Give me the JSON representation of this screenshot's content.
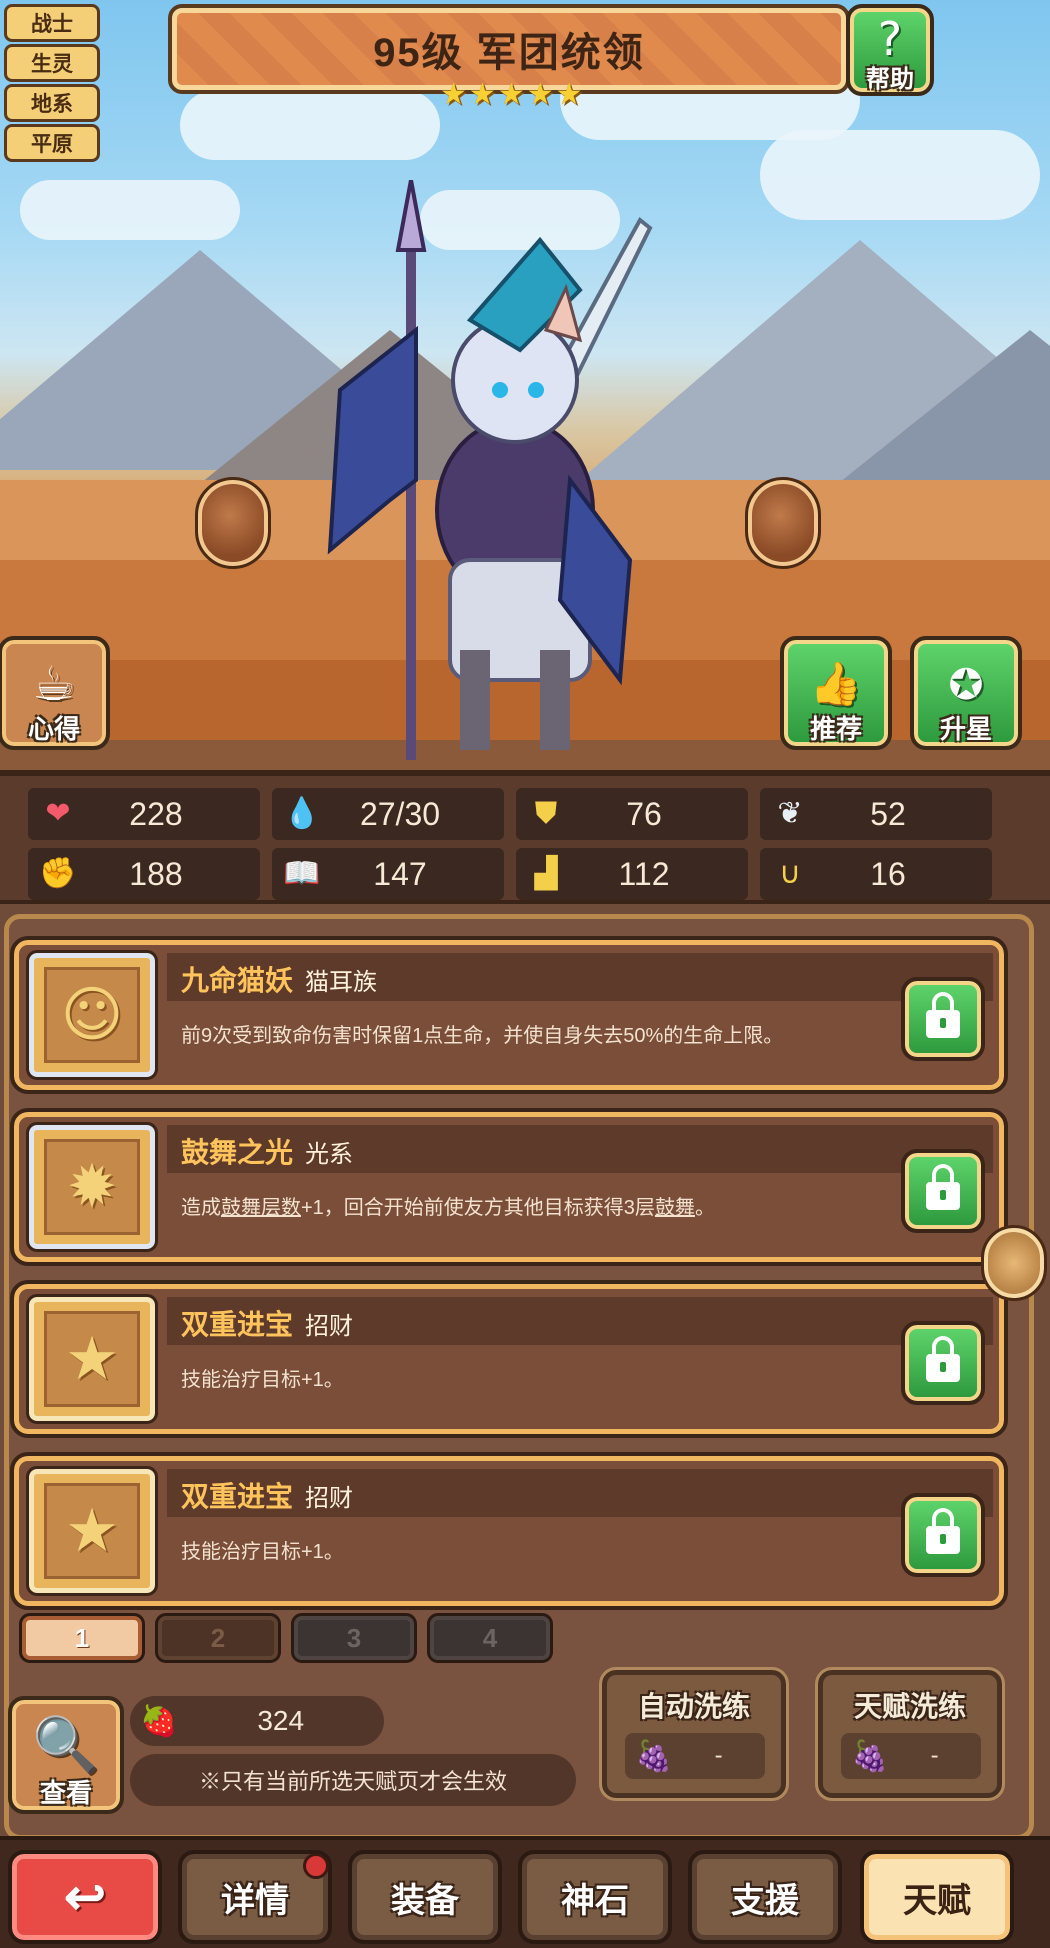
{
  "hero": {
    "tags": [
      "战士",
      "生灵",
      "地系",
      "平原"
    ],
    "title": "95级  军团统领",
    "stars": 5
  },
  "scene_buttons": {
    "help": "帮助",
    "notes": "心得",
    "recommend": "推荐",
    "upstar": "升星"
  },
  "icons": {
    "help": "question-mark-icon",
    "notes": "notes-icon",
    "recommend": "thumbs-up-icon",
    "upstar": "star-up-icon",
    "view": "magnifier-icon",
    "back": "back-arrow-icon",
    "lock": "lock-icon",
    "currency": "fruit-icon"
  },
  "stats": [
    {
      "icon": "heart-icon",
      "value": "228",
      "color": "#f45a6a"
    },
    {
      "icon": "water-drop-icon",
      "value": "27/30",
      "color": "#7fd0f4"
    },
    {
      "icon": "shield-icon",
      "value": "76",
      "color": "#f4d04a"
    },
    {
      "icon": "wing-icon",
      "value": "52",
      "color": "#e8eef6"
    },
    {
      "icon": "fist-icon",
      "value": "188",
      "color": "#f47a6a"
    },
    {
      "icon": "book-icon",
      "value": "147",
      "color": "#7fd0f4"
    },
    {
      "icon": "boot-icon",
      "value": "112",
      "color": "#f4d04a"
    },
    {
      "icon": "horseshoe-icon",
      "value": "16",
      "color": "#f4d04a"
    }
  ],
  "talents": [
    {
      "name": "九命猫妖",
      "type": "猫耳族",
      "desc_parts": [
        "前9次受到致命伤害时保留1点生命，并使自身失去50%的生命上限。"
      ],
      "icon": "cat-head-icon",
      "icon_glyph": "☺"
    },
    {
      "name": "鼓舞之光",
      "type": "光系",
      "desc_parts": [
        "造成",
        "鼓舞层数",
        "+1，回合开始前使友方其他目标获得3层",
        "鼓舞",
        "。"
      ],
      "icon": "sun-icon",
      "icon_glyph": "✹"
    },
    {
      "name": "双重进宝",
      "type": "招财",
      "desc_parts": [
        "技能治疗目标+1。"
      ],
      "icon": "star-exclaim-icon",
      "icon_glyph": "★"
    },
    {
      "name": "双重进宝",
      "type": "招财",
      "desc_parts": [
        "技能治疗目标+1。"
      ],
      "icon": "star-exclaim-icon",
      "icon_glyph": "★"
    }
  ],
  "pages": [
    "1",
    "2",
    "3",
    "4"
  ],
  "currency": {
    "value": "324"
  },
  "hint": "※只有当前所选天赋页才会生效",
  "view_label": "查看",
  "wash": {
    "auto": {
      "title": "自动洗练",
      "cost": "-"
    },
    "talent": {
      "title": "天赋洗练",
      "cost": "-"
    }
  },
  "nav": {
    "details": "详情",
    "equipment": "装备",
    "stone": "神石",
    "support": "支援",
    "talent": "天赋"
  }
}
